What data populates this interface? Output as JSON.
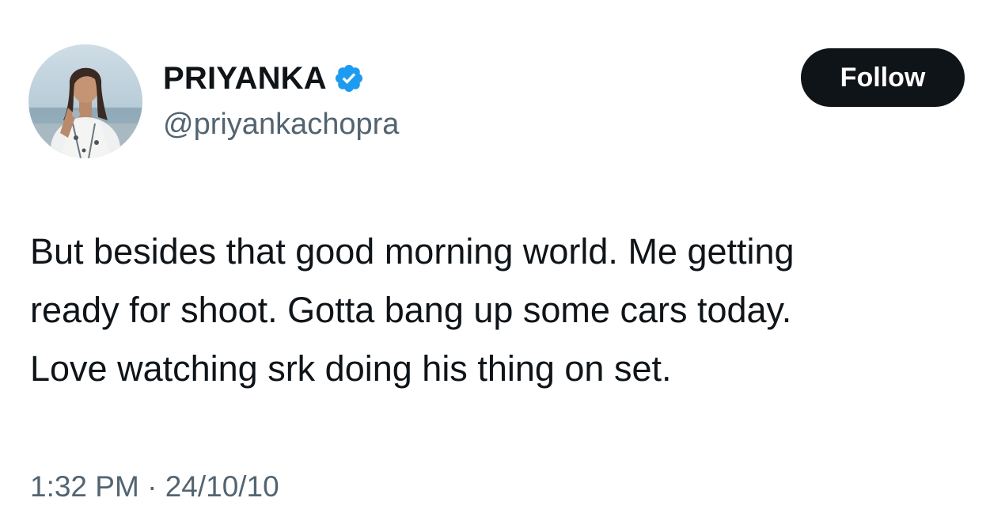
{
  "author": {
    "display_name": "PRIYANKA",
    "handle": "@priyankachopra",
    "verified": true,
    "verified_icon": "verified-badge-icon",
    "verified_color": "#1d9bf0"
  },
  "follow_button": {
    "label": "Follow",
    "background": "#0f1419",
    "text_color": "#ffffff"
  },
  "tweet": {
    "lines": [
      "But besides that good morning world. Me getting",
      "ready for shoot. Gotta bang up some cars today.",
      "Love watching srk doing his thing on set."
    ],
    "time": "1:32 PM",
    "separator": "·",
    "date": "24/10/10"
  },
  "colors": {
    "text_primary": "#0f1419",
    "text_secondary": "#536471"
  }
}
